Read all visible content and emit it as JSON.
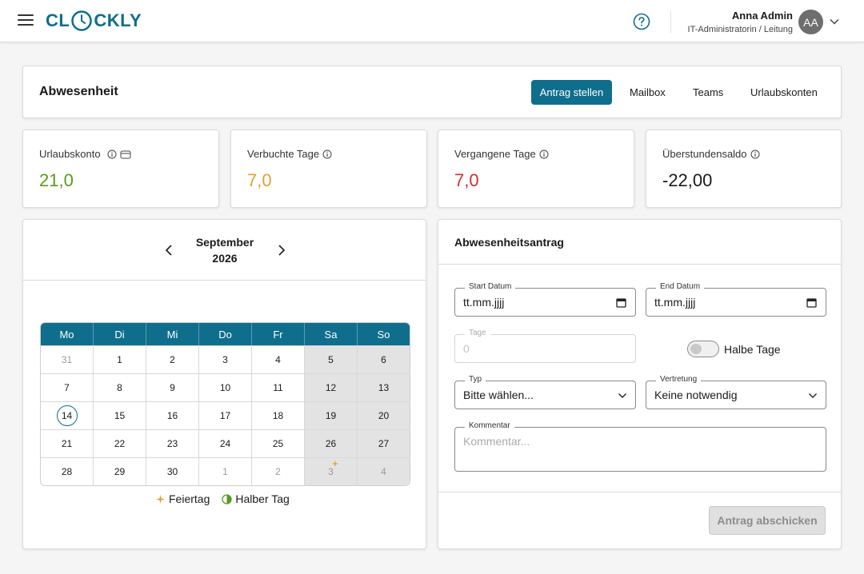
{
  "app": {
    "logo_prefix": "CL",
    "logo_suffix": "CKLY"
  },
  "user": {
    "name": "Anna Admin",
    "role": "IT-Administratorin / Leitung",
    "initials": "AA"
  },
  "header": {
    "title": "Abwesenheit",
    "primary_button": "Antrag stellen",
    "nav": [
      "Mailbox",
      "Teams",
      "Urlaubskonten"
    ]
  },
  "stats": [
    {
      "label": "Urlaubskonto",
      "value": "21,0",
      "color": "#5a9a1f"
    },
    {
      "label": "Verbuchte Tage",
      "value": "7,0",
      "color": "#e0a32e"
    },
    {
      "label": "Vergangene Tage",
      "value": "7,0",
      "color": "#d32f2f"
    },
    {
      "label": "Überstundensaldo",
      "value": "-22,00",
      "color": "#1a1a1a"
    }
  ],
  "calendar": {
    "month": "September",
    "year": "2026",
    "weekdays": [
      "Mo",
      "Di",
      "Mi",
      "Do",
      "Fr",
      "Sa",
      "So"
    ],
    "weeks": [
      [
        "31",
        "1",
        "2",
        "3",
        "4",
        "5",
        "6"
      ],
      [
        "7",
        "8",
        "9",
        "10",
        "11",
        "12",
        "13"
      ],
      [
        "14",
        "15",
        "16",
        "17",
        "18",
        "19",
        "20"
      ],
      [
        "21",
        "22",
        "23",
        "24",
        "25",
        "26",
        "27"
      ],
      [
        "28",
        "29",
        "30",
        "1",
        "2",
        "3",
        "4"
      ]
    ],
    "today": "14",
    "legend": {
      "holiday": "Feiertag",
      "half_day": "Halber Tag"
    }
  },
  "form": {
    "title": "Abwesenheitsantrag",
    "start_label": "Start Datum",
    "start_value": "tt.mm.jjjj",
    "end_label": "End Datum",
    "end_value": "tt.mm.jjjj",
    "days_label": "Tage",
    "days_value": "0",
    "half_days_label": "Halbe Tage",
    "type_label": "Typ",
    "type_value": "Bitte wählen...",
    "substitute_label": "Vertretung",
    "substitute_value": "Keine notwendig",
    "comment_label": "Kommentar",
    "comment_placeholder": "Kommentar...",
    "submit": "Antrag abschicken"
  },
  "colors": {
    "accent": "#0f6e8c",
    "holiday": "#e0a32e",
    "half_day": "#5a9a1f"
  }
}
